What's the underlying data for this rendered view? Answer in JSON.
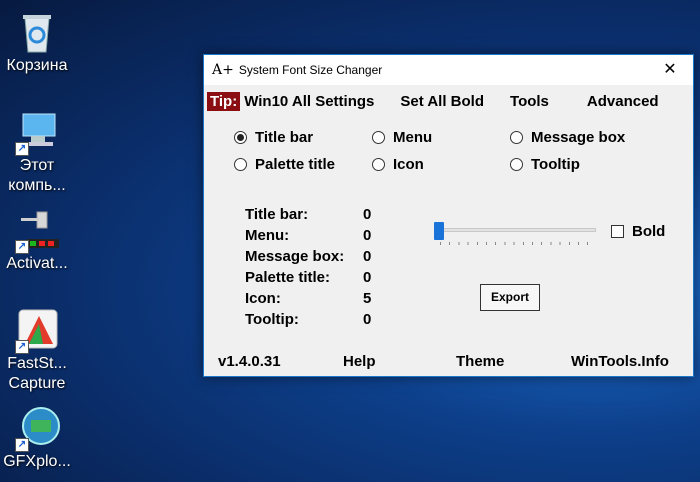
{
  "desktop": {
    "icons": [
      {
        "label": "Корзина"
      },
      {
        "label": "Этот компь..."
      },
      {
        "label": "Activat..."
      },
      {
        "label": "FastSt... Capture"
      },
      {
        "label": "GFXplo..."
      }
    ]
  },
  "window": {
    "title": "System Font Size Changer",
    "app_icon": "A+",
    "close_glyph": "✕"
  },
  "menu": {
    "tip": "Tip:",
    "items": [
      "Win10 All Settings",
      "Set All Bold",
      "Tools",
      "Advanced"
    ]
  },
  "radios": [
    {
      "label": "Title bar",
      "selected": true
    },
    {
      "label": "Menu",
      "selected": false
    },
    {
      "label": "Message box",
      "selected": false
    },
    {
      "label": "Palette title",
      "selected": false
    },
    {
      "label": "Icon",
      "selected": false
    },
    {
      "label": "Tooltip",
      "selected": false
    }
  ],
  "values": [
    {
      "label": "Title bar:",
      "value": "0"
    },
    {
      "label": "Menu:",
      "value": "0"
    },
    {
      "label": "Message box:",
      "value": "0"
    },
    {
      "label": "Palette title:",
      "value": "0"
    },
    {
      "label": "Icon:",
      "value": "5"
    },
    {
      "label": "Tooltip:",
      "value": "0"
    }
  ],
  "slider": {
    "value": 0
  },
  "bold_label": "Bold",
  "export_label": "Export",
  "footer": {
    "version": "v1.4.0.31",
    "help": "Help",
    "theme": "Theme",
    "site": "WinTools.Info"
  },
  "colors": {
    "tip_bg": "#8b0f12",
    "accent": "#1a73d9"
  }
}
